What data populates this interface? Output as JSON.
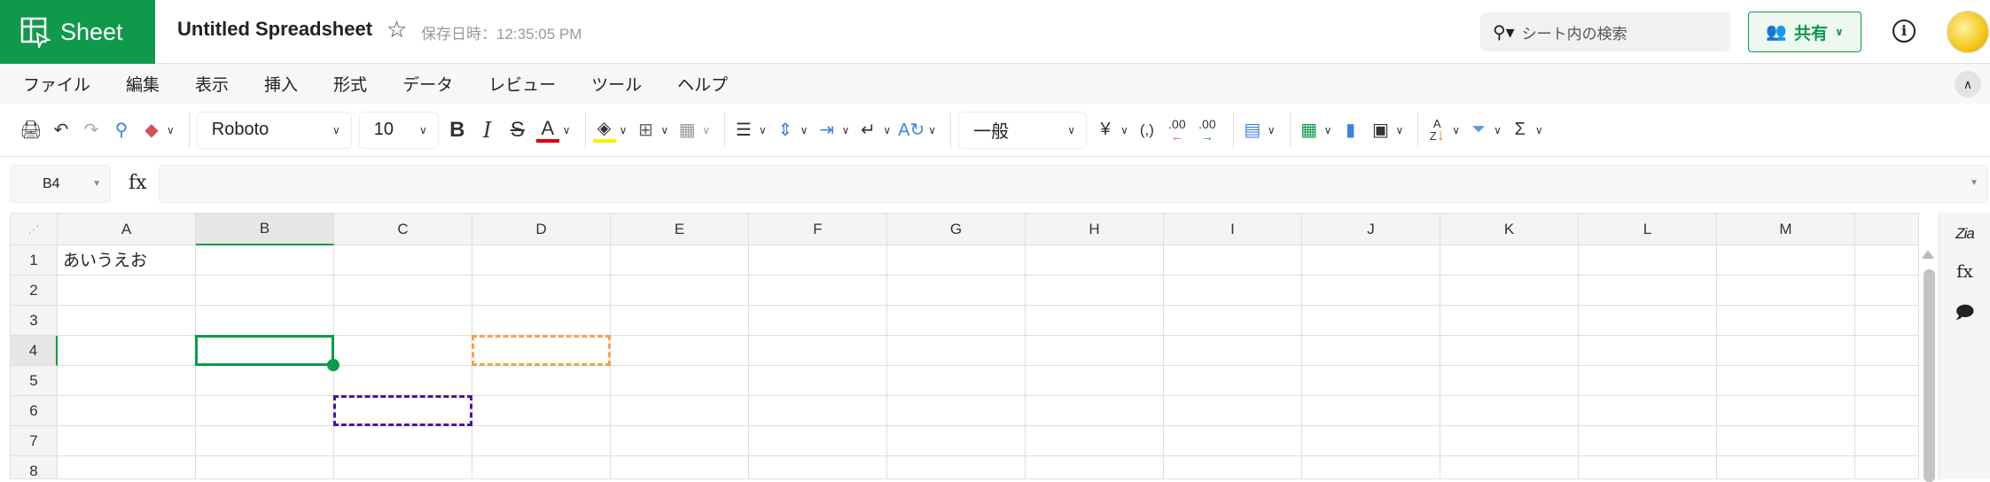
{
  "app": {
    "name": "Sheet",
    "doc_title": "Untitled Spreadsheet",
    "saved_status": "保存日時：12:35:05 PM"
  },
  "header": {
    "search_placeholder": "シート内の検索",
    "share_label": "共有",
    "info_label": "i"
  },
  "menu": [
    "ファイル",
    "編集",
    "表示",
    "挿入",
    "形式",
    "データ",
    "レビュー",
    "ツール",
    "ヘルプ"
  ],
  "toolbar": {
    "font": "Roboto",
    "font_size": "10",
    "number_format": "一般",
    "currency": "¥",
    "comma": "(,)",
    "decimal": ".00"
  },
  "formula_bar": {
    "cell_ref": "B4",
    "fx_label": "fx",
    "formula": ""
  },
  "grid": {
    "columns": [
      "A",
      "B",
      "C",
      "D",
      "E",
      "F",
      "G",
      "H",
      "I",
      "J",
      "K",
      "L",
      "M",
      ""
    ],
    "rows": [
      "1",
      "2",
      "3",
      "4",
      "5",
      "6",
      "7",
      "8"
    ],
    "cells": {
      "A1": "あいうえお"
    },
    "active_cell": "B4",
    "copy_ranges": [
      {
        "cell": "D4",
        "color": "#f5a04a"
      },
      {
        "cell": "C6",
        "color": "#4a12b0"
      }
    ]
  },
  "side_panel": {
    "zia": "Zia",
    "fx": "fx"
  },
  "colors": {
    "brand": "#0e9a4a",
    "font_color": "#e00000",
    "fill_color": "#ffee00"
  }
}
